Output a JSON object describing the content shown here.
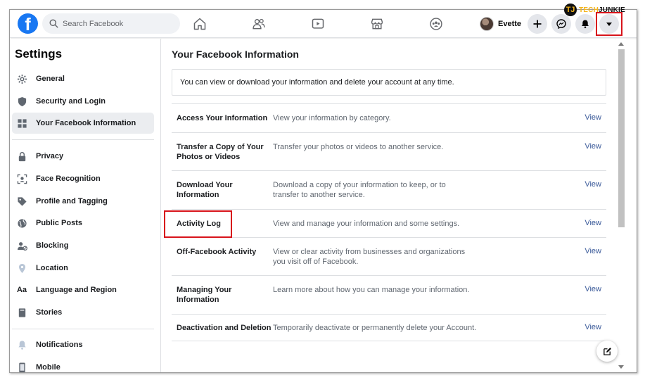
{
  "search": {
    "placeholder": "Search Facebook"
  },
  "profile": {
    "name": "Evette"
  },
  "watermark": {
    "tech": "TECH",
    "junkie": "JUNKIE"
  },
  "sidebar": {
    "title": "Settings",
    "groups": [
      [
        {
          "label": "General",
          "icon": "gear-icon"
        },
        {
          "label": "Security and Login",
          "icon": "shield-icon"
        },
        {
          "label": "Your Facebook Information",
          "icon": "grid-icon",
          "active": true
        }
      ],
      [
        {
          "label": "Privacy",
          "icon": "lock-icon"
        },
        {
          "label": "Face Recognition",
          "icon": "face-recognition-icon"
        },
        {
          "label": "Profile and Tagging",
          "icon": "tag-icon"
        },
        {
          "label": "Public Posts",
          "icon": "globe-icon"
        },
        {
          "label": "Blocking",
          "icon": "block-icon"
        },
        {
          "label": "Location",
          "icon": "location-icon"
        },
        {
          "label": "Language and Region",
          "icon": "language-icon"
        },
        {
          "label": "Stories",
          "icon": "book-icon"
        }
      ],
      [
        {
          "label": "Notifications",
          "icon": "bell-icon"
        },
        {
          "label": "Mobile",
          "icon": "phone-icon"
        }
      ]
    ]
  },
  "main": {
    "title": "Your Facebook Information",
    "info": "You can view or download your information and delete your account at any time.",
    "rows": [
      {
        "title": "Access Your Information",
        "desc": "View your information by category.",
        "link": "View"
      },
      {
        "title": "Transfer a Copy of Your Photos or Videos",
        "desc": "Transfer your photos or videos to another service.",
        "link": "View"
      },
      {
        "title": "Download Your Information",
        "desc": "Download a copy of your information to keep, or to transfer to another service.",
        "link": "View"
      },
      {
        "title": "Activity Log",
        "desc": "View and manage your information and some settings.",
        "link": "View",
        "highlighted": true
      },
      {
        "title": "Off-Facebook Activity",
        "desc": "View or clear activity from businesses and organizations you visit off of Facebook.",
        "link": "View"
      },
      {
        "title": "Managing Your Information",
        "desc": "Learn more about how you can manage your information.",
        "link": "View"
      },
      {
        "title": "Deactivation and Deletion",
        "desc": "Temporarily deactivate or permanently delete your Account.",
        "link": "View"
      }
    ]
  },
  "colors": {
    "brand": "#1877f2",
    "link": "#385898",
    "highlight": "#d8141b"
  }
}
